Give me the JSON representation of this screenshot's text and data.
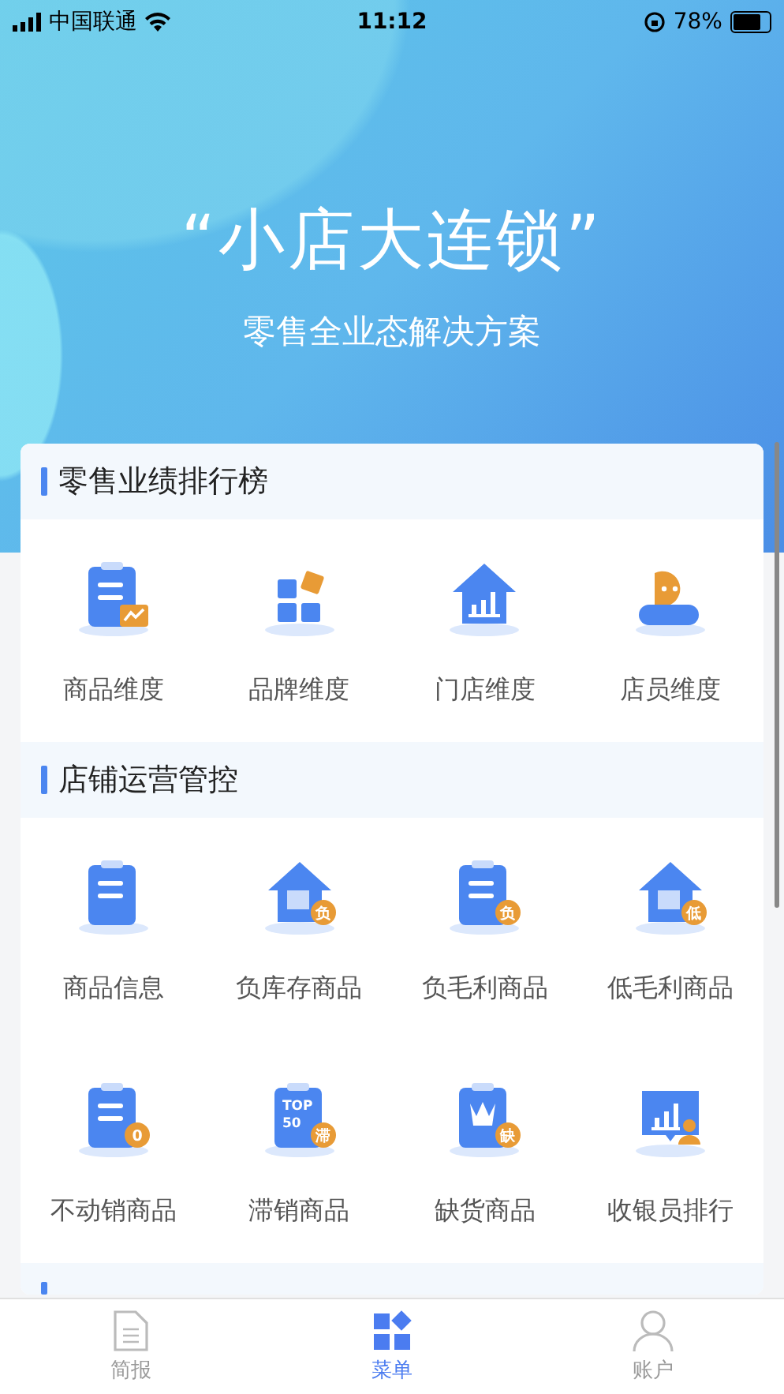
{
  "status_bar": {
    "carrier": "中国联通",
    "time": "11:12",
    "battery": "78%"
  },
  "hero": {
    "title": "“小店大连锁”",
    "subtitle": "零售全业态解决方案"
  },
  "sections": [
    {
      "title": "零售业绩排行榜",
      "items": [
        {
          "label": "商品维度",
          "icon": {
            "kind": "clipboard_chart"
          }
        },
        {
          "label": "品牌维度",
          "icon": {
            "kind": "blocks"
          }
        },
        {
          "label": "门店维度",
          "icon": {
            "kind": "house_bars"
          }
        },
        {
          "label": "店员维度",
          "icon": {
            "kind": "person"
          }
        }
      ]
    },
    {
      "title": "店铺运营管控",
      "items": [
        {
          "label": "商品信息",
          "icon": {
            "kind": "clipboard"
          }
        },
        {
          "label": "负库存商品",
          "icon": {
            "kind": "house_box",
            "badge": "负"
          }
        },
        {
          "label": "负毛利商品",
          "icon": {
            "kind": "clipboard",
            "badge": "负"
          }
        },
        {
          "label": "低毛利商品",
          "icon": {
            "kind": "house_box",
            "badge": "低"
          }
        },
        {
          "label": "不动销商品",
          "icon": {
            "kind": "clipboard",
            "badge": "0"
          }
        },
        {
          "label": "滞销商品",
          "icon": {
            "kind": "top",
            "lines": [
              "TOP",
              "50"
            ],
            "badge": "滞"
          }
        },
        {
          "label": "缺货商品",
          "icon": {
            "kind": "crown",
            "badge": "缺"
          }
        },
        {
          "label": "收银员排行",
          "icon": {
            "kind": "monitor"
          }
        }
      ]
    },
    {
      "kind": "cut_header"
    }
  ],
  "tabs": [
    {
      "label": "简报",
      "selected": false
    },
    {
      "label": "菜单",
      "selected": true
    },
    {
      "label": "账户",
      "selected": false
    }
  ]
}
